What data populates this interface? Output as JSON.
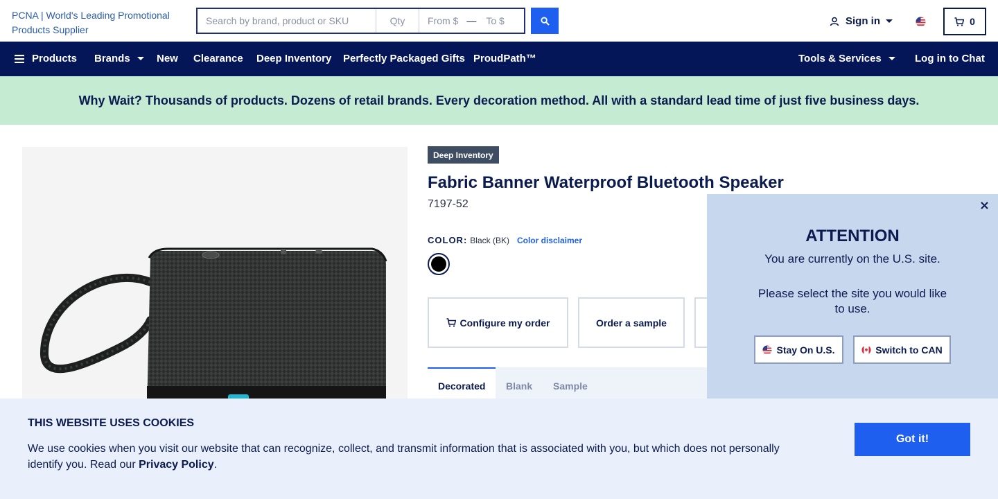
{
  "header": {
    "logo_alt": "PCNA | World's Leading Promotional Products Supplier",
    "search_placeholder": "Search by brand, product or SKU",
    "qty_placeholder": "Qty",
    "from_placeholder": "From $",
    "range_dash": "—",
    "to_placeholder": "To $",
    "signin_label": "Sign in",
    "cart_count": "0"
  },
  "nav": {
    "products": "Products",
    "brands": "Brands",
    "new": "New",
    "clearance": "Clearance",
    "deep_inventory": "Deep Inventory",
    "gifts": "Perfectly Packaged Gifts",
    "proudpath": "ProudPath™",
    "tools": "Tools & Services",
    "chat": "Log in to Chat"
  },
  "promo": {
    "text": "Why Wait? Thousands of products. Dozens of retail brands. Every decoration method. All with a standard lead time of just five business days."
  },
  "product": {
    "badge": "Deep Inventory",
    "title": "Fabric Banner Waterproof Bluetooth Speaker",
    "sku": "7197-52",
    "color_label": "COLOR:",
    "color_value": "Black (BK)",
    "color_disclaimer": "Color disclaimer",
    "swatch_color": "#000000",
    "configure_label": "Configure my order",
    "sample_label": "Order a sample",
    "tabs": {
      "decorated": "Decorated",
      "blank": "Blank",
      "sample": "Sample"
    }
  },
  "attention": {
    "title": "ATTENTION",
    "message1": "You are currently on the U.S. site.",
    "message2": "Please select the site you would like to use.",
    "stay_label": "Stay On U.S.",
    "switch_label": "Switch to CAN"
  },
  "cookies": {
    "title": "THIS WEBSITE USES COOKIES",
    "text": "We use cookies when you visit our website that can recognize, collect, and transmit information that is associated with you, but which does not personally identify you. Read our ",
    "policy_link": "Privacy Policy",
    "period": ".",
    "button": "Got it!"
  },
  "colors": {
    "navy": "#051658",
    "accent_blue": "#1f5ff0",
    "promo_green": "#c5ecd2",
    "modal_bg": "#c7d7ee",
    "cookie_bg": "#e9f0fb"
  }
}
